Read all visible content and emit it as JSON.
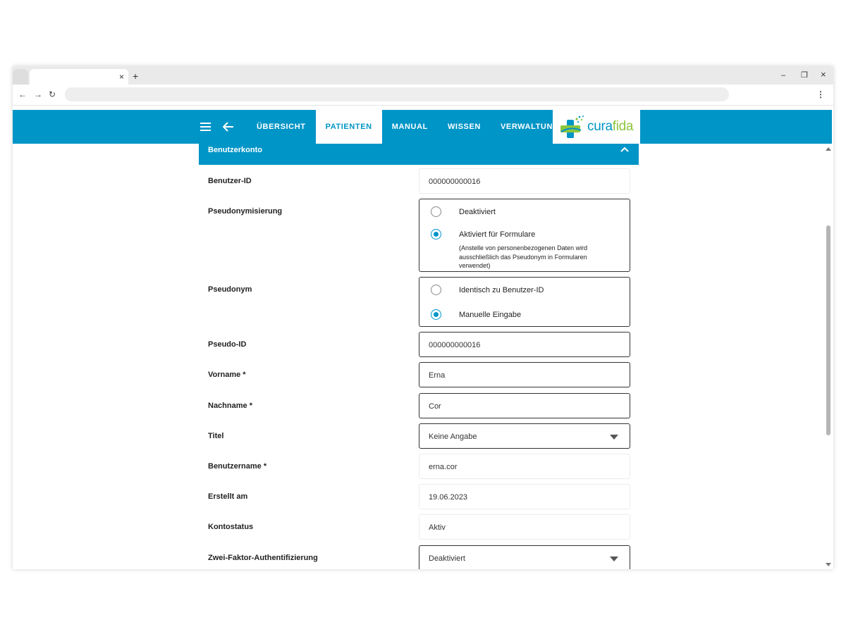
{
  "browser": {
    "tab_close": "×",
    "new_tab": "+",
    "minimize": "–",
    "restore": "❐",
    "close": "×",
    "back": "←",
    "forward": "→",
    "reload": "↻",
    "menu": "⋮"
  },
  "nav": {
    "items": [
      "ÜBERSICHT",
      "PATIENTEN",
      "MANUAL",
      "WISSEN",
      "VERWALTUNG"
    ],
    "active": "PATIENTEN"
  },
  "logo": {
    "part1": "cura",
    "part2": "fida"
  },
  "colors": {
    "accent": "#0095c7",
    "logo_green": "#8cc63f"
  },
  "section": {
    "title": "Benutzerkonto"
  },
  "form": {
    "benutzer_id": {
      "label": "Benutzer-ID",
      "value": "000000000016"
    },
    "pseudonymisierung": {
      "label": "Pseudonymisierung",
      "options": [
        "Deaktiviert",
        "Aktiviert für Formulare"
      ],
      "selected": "Aktiviert für Formulare",
      "hint": "(Anstelle von personenbezogenen Daten wird ausschließlich das Pseudonym in Formularen verwendet)"
    },
    "pseudonym": {
      "label": "Pseudonym",
      "options": [
        "Identisch zu Benutzer-ID",
        "Manuelle Eingabe"
      ],
      "selected": "Manuelle Eingabe"
    },
    "pseudo_id": {
      "label": "Pseudo-ID",
      "value": "000000000016"
    },
    "vorname": {
      "label": "Vorname *",
      "value": "Erna"
    },
    "nachname": {
      "label": "Nachname *",
      "value": "Cor"
    },
    "titel": {
      "label": "Titel",
      "value": "Keine Angabe"
    },
    "benutzername": {
      "label": "Benutzername *",
      "value": "erna.cor"
    },
    "erstellt": {
      "label": "Erstellt am",
      "value": "19.06.2023"
    },
    "kontostatus": {
      "label": "Kontostatus",
      "value": "Aktiv"
    },
    "zwei_faktor": {
      "label": "Zwei-Faktor-Authentifizierung",
      "value": "Deaktiviert"
    }
  }
}
